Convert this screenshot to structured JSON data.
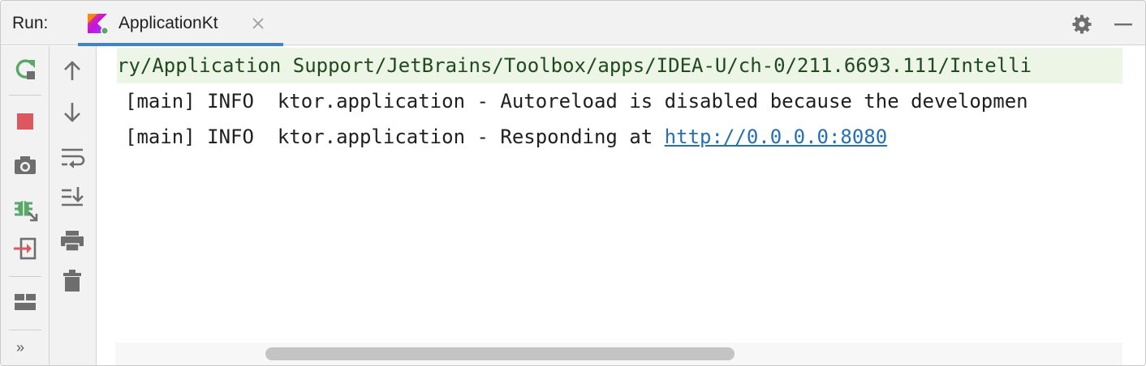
{
  "header": {
    "run_label": "Run:",
    "tab": {
      "title": "ApplicationKt",
      "icon": "kotlin-run-icon"
    }
  },
  "toolbar_left": [
    {
      "name": "rerun-icon",
      "color": "#59a869"
    },
    {
      "name": "stop-icon",
      "color": "#db5860"
    },
    {
      "name": "camera-icon",
      "color": "#6e6e6e"
    },
    {
      "name": "debug-icon",
      "color": "#59a869"
    },
    {
      "name": "exit-icon",
      "color": "#db5860"
    },
    {
      "name": "layout-icon",
      "color": "#6e6e6e"
    }
  ],
  "toolbar_second": [
    {
      "name": "arrow-up-icon"
    },
    {
      "name": "arrow-down-icon"
    },
    {
      "name": "soft-wrap-icon"
    },
    {
      "name": "scroll-to-end-icon"
    },
    {
      "name": "print-icon"
    },
    {
      "name": "trash-icon"
    }
  ],
  "more_label": "»",
  "console": {
    "command_line": "ry/Application Support/JetBrains/Toolbox/apps/IDEA-U/ch-0/211.6693.111/Intelli",
    "line1": "[main] INFO  ktor.application - Autoreload is disabled because the developmen",
    "line2_prefix": "[main] INFO  ktor.application - Responding at ",
    "line2_link": "http://0.0.0.0:8080"
  },
  "colors": {
    "accent": "#4083c9",
    "link": "#2470b3",
    "command_bg": "#edf5e6",
    "command_text": "#1f4a1f"
  }
}
